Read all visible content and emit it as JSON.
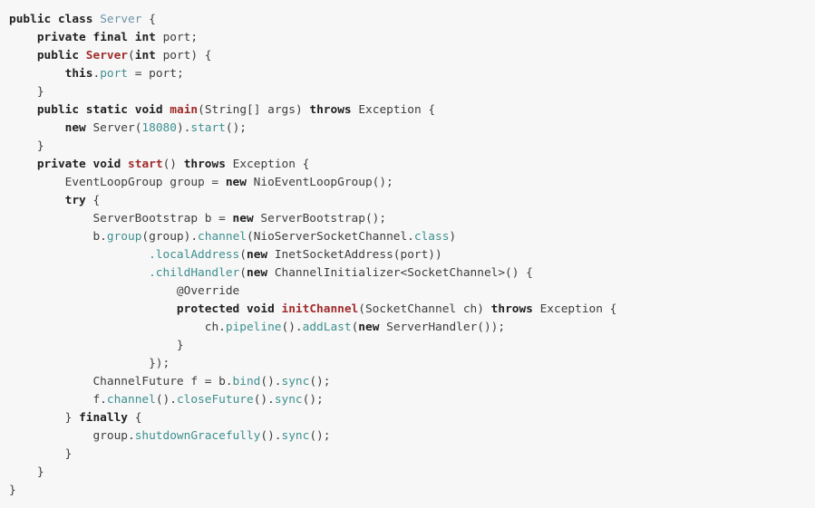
{
  "editor": {
    "language": "Java",
    "background_color": "#f7f7f7",
    "default_text_color": "#3c3c3c",
    "keyword_color": "#1f1f1f",
    "declaration_color": "#a02b2b",
    "type_declaration_color": "#6d92a8",
    "method_call_color": "#3d8f8f",
    "number_color": "#3d8f8f",
    "font_size_px": 12.8,
    "line_height_px": 20,
    "indent_unit_spaces": 4
  },
  "code": {
    "lines": [
      {
        "indent": 0,
        "tokens": [
          {
            "kind": "kw",
            "text": "public"
          },
          {
            "kind": "plain",
            "text": " "
          },
          {
            "kind": "kw",
            "text": "class"
          },
          {
            "kind": "plain",
            "text": " "
          },
          {
            "kind": "type",
            "text": "Server"
          },
          {
            "kind": "plain",
            "text": " {"
          }
        ]
      },
      {
        "indent": 1,
        "tokens": [
          {
            "kind": "kw",
            "text": "private"
          },
          {
            "kind": "plain",
            "text": " "
          },
          {
            "kind": "kw",
            "text": "final"
          },
          {
            "kind": "plain",
            "text": " "
          },
          {
            "kind": "kw",
            "text": "int"
          },
          {
            "kind": "plain",
            "text": " port;"
          }
        ]
      },
      {
        "indent": 1,
        "tokens": [
          {
            "kind": "kw",
            "text": "public"
          },
          {
            "kind": "plain",
            "text": " "
          },
          {
            "kind": "decl",
            "text": "Server"
          },
          {
            "kind": "plain",
            "text": "("
          },
          {
            "kind": "kw",
            "text": "int"
          },
          {
            "kind": "plain",
            "text": " port) {"
          }
        ]
      },
      {
        "indent": 2,
        "tokens": [
          {
            "kind": "kw",
            "text": "this"
          },
          {
            "kind": "plain",
            "text": "."
          },
          {
            "kind": "call",
            "text": "port"
          },
          {
            "kind": "plain",
            "text": " = port;"
          }
        ]
      },
      {
        "indent": 1,
        "tokens": [
          {
            "kind": "plain",
            "text": "}"
          }
        ]
      },
      {
        "indent": 1,
        "tokens": [
          {
            "kind": "kw",
            "text": "public"
          },
          {
            "kind": "plain",
            "text": " "
          },
          {
            "kind": "kw",
            "text": "static"
          },
          {
            "kind": "plain",
            "text": " "
          },
          {
            "kind": "kw",
            "text": "void"
          },
          {
            "kind": "plain",
            "text": " "
          },
          {
            "kind": "decl",
            "text": "main"
          },
          {
            "kind": "plain",
            "text": "(String[] args) "
          },
          {
            "kind": "kw",
            "text": "throws"
          },
          {
            "kind": "plain",
            "text": " Exception {"
          }
        ]
      },
      {
        "indent": 2,
        "tokens": [
          {
            "kind": "kw",
            "text": "new"
          },
          {
            "kind": "plain",
            "text": " Server("
          },
          {
            "kind": "num",
            "text": "18080"
          },
          {
            "kind": "plain",
            "text": ")."
          },
          {
            "kind": "call",
            "text": "start"
          },
          {
            "kind": "plain",
            "text": "();"
          }
        ]
      },
      {
        "indent": 1,
        "tokens": [
          {
            "kind": "plain",
            "text": "}"
          }
        ]
      },
      {
        "indent": 1,
        "tokens": [
          {
            "kind": "kw",
            "text": "private"
          },
          {
            "kind": "plain",
            "text": " "
          },
          {
            "kind": "kw",
            "text": "void"
          },
          {
            "kind": "plain",
            "text": " "
          },
          {
            "kind": "decl",
            "text": "start"
          },
          {
            "kind": "plain",
            "text": "() "
          },
          {
            "kind": "kw",
            "text": "throws"
          },
          {
            "kind": "plain",
            "text": " Exception {"
          }
        ]
      },
      {
        "indent": 2,
        "tokens": [
          {
            "kind": "plain",
            "text": "EventLoopGroup group = "
          },
          {
            "kind": "kw",
            "text": "new"
          },
          {
            "kind": "plain",
            "text": " NioEventLoopGroup();"
          }
        ]
      },
      {
        "indent": 2,
        "tokens": [
          {
            "kind": "kw",
            "text": "try"
          },
          {
            "kind": "plain",
            "text": " {"
          }
        ]
      },
      {
        "indent": 3,
        "tokens": [
          {
            "kind": "plain",
            "text": "ServerBootstrap b = "
          },
          {
            "kind": "kw",
            "text": "new"
          },
          {
            "kind": "plain",
            "text": " ServerBootstrap();"
          }
        ]
      },
      {
        "indent": 3,
        "tokens": [
          {
            "kind": "plain",
            "text": "b."
          },
          {
            "kind": "call",
            "text": "group"
          },
          {
            "kind": "plain",
            "text": "(group)."
          },
          {
            "kind": "call",
            "text": "channel"
          },
          {
            "kind": "plain",
            "text": "(NioServerSocketChannel."
          },
          {
            "kind": "call",
            "text": "class"
          },
          {
            "kind": "plain",
            "text": ")"
          }
        ]
      },
      {
        "indent": 5,
        "tokens": [
          {
            "kind": "call",
            "text": ".localAddress"
          },
          {
            "kind": "plain",
            "text": "("
          },
          {
            "kind": "kw",
            "text": "new"
          },
          {
            "kind": "plain",
            "text": " InetSocketAddress(port))"
          }
        ]
      },
      {
        "indent": 5,
        "tokens": [
          {
            "kind": "call",
            "text": ".childHandler"
          },
          {
            "kind": "plain",
            "text": "("
          },
          {
            "kind": "kw",
            "text": "new"
          },
          {
            "kind": "plain",
            "text": " ChannelInitializer<SocketChannel>() {"
          }
        ]
      },
      {
        "indent": 6,
        "tokens": [
          {
            "kind": "anno",
            "text": "@Override"
          }
        ]
      },
      {
        "indent": 6,
        "tokens": [
          {
            "kind": "kw",
            "text": "protected"
          },
          {
            "kind": "plain",
            "text": " "
          },
          {
            "kind": "kw",
            "text": "void"
          },
          {
            "kind": "plain",
            "text": " "
          },
          {
            "kind": "decl",
            "text": "initChannel"
          },
          {
            "kind": "plain",
            "text": "(SocketChannel ch) "
          },
          {
            "kind": "kw",
            "text": "throws"
          },
          {
            "kind": "plain",
            "text": " Exception {"
          }
        ]
      },
      {
        "indent": 7,
        "tokens": [
          {
            "kind": "plain",
            "text": "ch."
          },
          {
            "kind": "call",
            "text": "pipeline"
          },
          {
            "kind": "plain",
            "text": "()."
          },
          {
            "kind": "call",
            "text": "addLast"
          },
          {
            "kind": "plain",
            "text": "("
          },
          {
            "kind": "kw",
            "text": "new"
          },
          {
            "kind": "plain",
            "text": " ServerHandler());"
          }
        ]
      },
      {
        "indent": 6,
        "tokens": [
          {
            "kind": "plain",
            "text": "}"
          }
        ]
      },
      {
        "indent": 5,
        "tokens": [
          {
            "kind": "plain",
            "text": "});"
          }
        ]
      },
      {
        "indent": 3,
        "tokens": [
          {
            "kind": "plain",
            "text": "ChannelFuture f = b."
          },
          {
            "kind": "call",
            "text": "bind"
          },
          {
            "kind": "plain",
            "text": "()."
          },
          {
            "kind": "call",
            "text": "sync"
          },
          {
            "kind": "plain",
            "text": "();"
          }
        ]
      },
      {
        "indent": 3,
        "tokens": [
          {
            "kind": "plain",
            "text": "f."
          },
          {
            "kind": "call",
            "text": "channel"
          },
          {
            "kind": "plain",
            "text": "()."
          },
          {
            "kind": "call",
            "text": "closeFuture"
          },
          {
            "kind": "plain",
            "text": "()."
          },
          {
            "kind": "call",
            "text": "sync"
          },
          {
            "kind": "plain",
            "text": "();"
          }
        ]
      },
      {
        "indent": 2,
        "tokens": [
          {
            "kind": "plain",
            "text": "} "
          },
          {
            "kind": "kw",
            "text": "finally"
          },
          {
            "kind": "plain",
            "text": " {"
          }
        ]
      },
      {
        "indent": 3,
        "tokens": [
          {
            "kind": "plain",
            "text": "group."
          },
          {
            "kind": "call",
            "text": "shutdownGracefully"
          },
          {
            "kind": "plain",
            "text": "()."
          },
          {
            "kind": "call",
            "text": "sync"
          },
          {
            "kind": "plain",
            "text": "();"
          }
        ]
      },
      {
        "indent": 2,
        "tokens": [
          {
            "kind": "plain",
            "text": "}"
          }
        ]
      },
      {
        "indent": 1,
        "tokens": [
          {
            "kind": "plain",
            "text": "}"
          }
        ]
      },
      {
        "indent": 0,
        "tokens": [
          {
            "kind": "plain",
            "text": "}"
          }
        ]
      }
    ]
  }
}
